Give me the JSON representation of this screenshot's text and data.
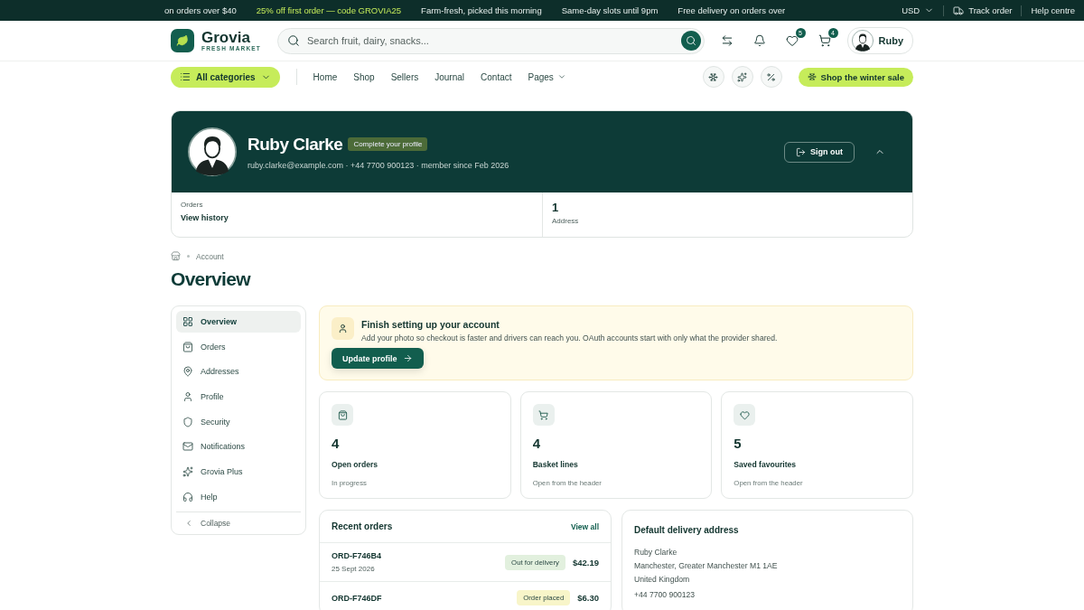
{
  "promo_bar": {
    "messages": [
      {
        "text": "on orders over $40",
        "highlight": false
      },
      {
        "text": "25% off first order — code GROVIA25",
        "highlight": true
      },
      {
        "text": "Farm-fresh, picked this morning",
        "highlight": false
      },
      {
        "text": "Same-day slots until 9pm",
        "highlight": false
      },
      {
        "text": "Free delivery on orders over",
        "highlight": false
      }
    ],
    "currency": "USD",
    "links": [
      "Track order",
      "Help centre"
    ]
  },
  "header": {
    "brand": {
      "name": "Grovia",
      "tagline": "FRESH MARKET"
    },
    "search": {
      "placeholder": "Search fruit, dairy, snacks..."
    },
    "favourites_count": "5",
    "cart_count": "4",
    "user": "Ruby"
  },
  "nav": {
    "categories": "All categories",
    "links": [
      {
        "label": "Home",
        "dropdown": false
      },
      {
        "label": "Shop",
        "dropdown": false
      },
      {
        "label": "Sellers",
        "dropdown": false
      },
      {
        "label": "Journal",
        "dropdown": false
      },
      {
        "label": "Contact",
        "dropdown": false
      },
      {
        "label": "Pages",
        "dropdown": true
      }
    ],
    "sale": "Shop the winter sale"
  },
  "profile": {
    "name": "Ruby Clarke",
    "badge": "Complete your profile",
    "details": "ruby.clarke@example.com · +44 7700 900123 · member since Feb 2026",
    "sign_out": "Sign out",
    "expanded": true,
    "stats": [
      {
        "kind": "link",
        "label": "Orders",
        "value": "View history"
      },
      {
        "kind": "count",
        "label": "Address",
        "value": "1"
      }
    ]
  },
  "breadcrumb": [
    "Account"
  ],
  "title": "Overview",
  "sidebar": {
    "items": [
      {
        "label": "Overview",
        "selected": true
      },
      {
        "label": "Orders",
        "selected": false
      },
      {
        "label": "Addresses",
        "selected": false
      },
      {
        "label": "Profile",
        "selected": false
      },
      {
        "label": "Security",
        "selected": false
      },
      {
        "label": "Notifications",
        "selected": false
      },
      {
        "label": "Grovia Plus",
        "selected": false
      },
      {
        "label": "Help",
        "selected": false
      }
    ],
    "collapse": "Collapse"
  },
  "setup": {
    "title": "Finish setting up your account",
    "text": "Add your photo so checkout is faster and drivers can reach you. OAuth accounts start with only what the provider shared.",
    "button": "Update profile"
  },
  "stats": [
    {
      "value": "4",
      "label": "Open orders",
      "note": "In progress"
    },
    {
      "value": "4",
      "label": "Basket lines",
      "note": "Open from the header"
    },
    {
      "value": "5",
      "label": "Saved favourites",
      "note": "Open from the header"
    }
  ],
  "recent_orders": {
    "title": "Recent orders",
    "view_all": "View all",
    "rows": [
      {
        "id": "ORD-F746B4",
        "date": "25 Sept 2026",
        "status": "Out for delivery",
        "color": "#e2f0de",
        "total": "$42.19"
      },
      {
        "id": "ORD-F746DF",
        "status": "Order placed",
        "color": "#f8f5c9",
        "total": "$6.30"
      }
    ]
  },
  "address": {
    "title": "Default delivery address",
    "lines": [
      "Ruby Clarke",
      "Manchester, Greater Manchester M1 1AE",
      "United Kingdom"
    ],
    "phone": "+44 7700 900123"
  }
}
